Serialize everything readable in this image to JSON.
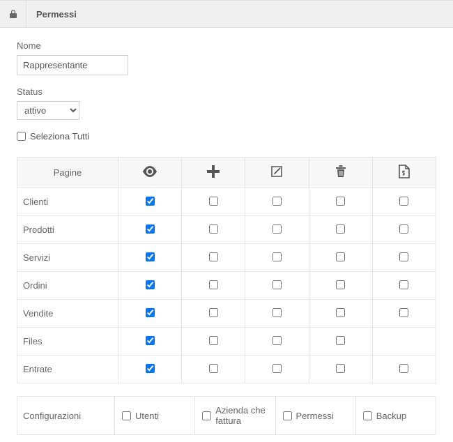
{
  "header": {
    "title": "Permessi"
  },
  "form": {
    "name_label": "Nome",
    "name_value": "Rappresentante",
    "status_label": "Status",
    "status_value": "attivo",
    "select_all_label": "Seleziona Tutti",
    "select_all_checked": false
  },
  "table": {
    "pages_header": "Pagine",
    "rows": [
      {
        "page": "Clienti",
        "view": true,
        "add": false,
        "edit": false,
        "delete": false,
        "pdf": false
      },
      {
        "page": "Prodotti",
        "view": true,
        "add": false,
        "edit": false,
        "delete": false,
        "pdf": false
      },
      {
        "page": "Servizi",
        "view": true,
        "add": false,
        "edit": false,
        "delete": false,
        "pdf": false
      },
      {
        "page": "Ordini",
        "view": true,
        "add": false,
        "edit": false,
        "delete": false,
        "pdf": false
      },
      {
        "page": "Vendite",
        "view": true,
        "add": false,
        "edit": false,
        "delete": false,
        "pdf": false
      },
      {
        "page": "Files",
        "view": true,
        "add": false,
        "edit": false,
        "delete": false,
        "pdf": null
      },
      {
        "page": "Entrate",
        "view": true,
        "add": false,
        "edit": false,
        "delete": false,
        "pdf": false
      }
    ]
  },
  "config": {
    "label": "Configurazioni",
    "items": [
      {
        "label": "Utenti",
        "checked": false
      },
      {
        "label": "Azienda che fattura",
        "checked": false
      },
      {
        "label": "Permessi",
        "checked": false
      },
      {
        "label": "Backup",
        "checked": false
      }
    ]
  }
}
